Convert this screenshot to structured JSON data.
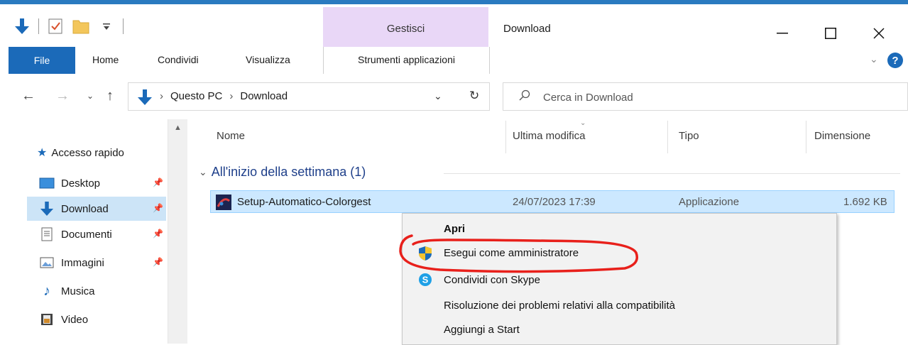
{
  "title_bar": {
    "contextual_tab": "Gestisci",
    "window_title": "Download"
  },
  "ribbon": {
    "tabs": [
      "File",
      "Home",
      "Condividi",
      "Visualizza",
      "Strumenti applicazioni"
    ]
  },
  "address": {
    "crumbs": [
      "Questo PC",
      "Download"
    ],
    "search_placeholder": "Cerca in Download"
  },
  "nav": {
    "quick_access": "Accesso rapido",
    "items": [
      {
        "label": "Desktop",
        "icon": "desktop-icon",
        "pinned": true
      },
      {
        "label": "Download",
        "icon": "download-icon",
        "pinned": true,
        "selected": true
      },
      {
        "label": "Documenti",
        "icon": "documents-icon",
        "pinned": true
      },
      {
        "label": "Immagini",
        "icon": "pictures-icon",
        "pinned": true
      },
      {
        "label": "Musica",
        "icon": "music-icon",
        "pinned": false
      },
      {
        "label": "Video",
        "icon": "video-icon",
        "pinned": false
      }
    ]
  },
  "columns": [
    "Nome",
    "Ultima modifica",
    "Tipo",
    "Dimensione"
  ],
  "group": {
    "label": "All'inizio della settimana (1)"
  },
  "files": [
    {
      "name": "Setup-Automatico-Colorgest",
      "modified": "24/07/2023 17:39",
      "type": "Applicazione",
      "size": "1.692 KB"
    }
  ],
  "context_menu": {
    "items": [
      {
        "label": "Apri",
        "bold": true
      },
      {
        "label": "Esegui come amministratore",
        "icon": "uac-shield-icon"
      },
      {
        "label": "Condividi con Skype",
        "icon": "skype-icon"
      },
      {
        "label": "Risoluzione dei problemi relativi alla compatibilità"
      },
      {
        "label": "Aggiungi a Start"
      }
    ]
  },
  "colors": {
    "accent": "#1b6ab9",
    "selection": "#cce8ff",
    "contextual_tab": "#e9d7f7",
    "highlight_mark": "#e8201b"
  }
}
